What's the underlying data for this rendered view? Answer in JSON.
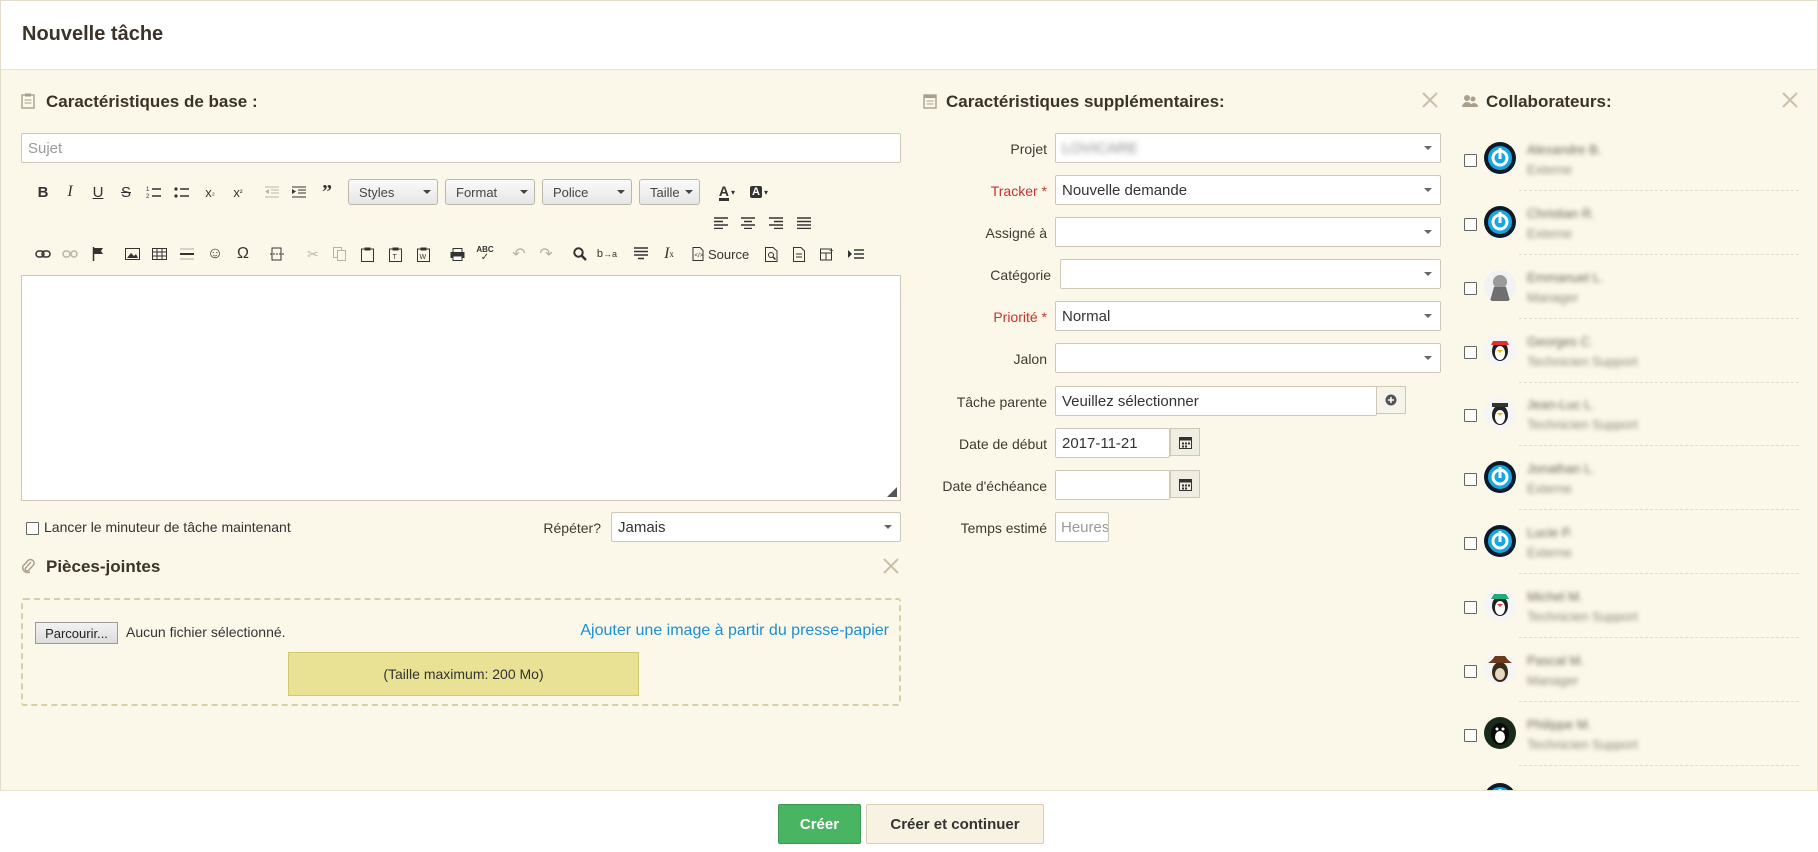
{
  "modal": {
    "title": "Nouvelle tâche"
  },
  "basic": {
    "title": "Caractéristiques de base :",
    "subject_placeholder": "Sujet",
    "toolbar": {
      "styles": "Styles",
      "format": "Format",
      "font": "Police",
      "size": "Taille",
      "source": "Source"
    },
    "timer_label": "Lancer le minuteur de tâche maintenant",
    "repeat_label": "Répéter?",
    "repeat_value": "Jamais"
  },
  "attachments": {
    "title": "Pièces-jointes",
    "browse": "Parcourir...",
    "no_file": "Aucun fichier sélectionné.",
    "paste_link": "Ajouter une image à partir du presse-papier",
    "max_size": "(Taille maximum: 200 Mo)"
  },
  "additional": {
    "title": "Caractéristiques supplémentaires:",
    "fields": {
      "project_label": "Projet",
      "project_value": "LOVICARE",
      "tracker_label": "Tracker *",
      "tracker_value": "Nouvelle demande",
      "assignee_label": "Assigné à",
      "category_label": "Catégorie",
      "priority_label": "Priorité *",
      "priority_value": "Normal",
      "milestone_label": "Jalon",
      "parent_label": "Tâche parente",
      "parent_value": "Veuillez sélectionner",
      "start_label": "Date de début",
      "start_value": "2017-11-21",
      "due_label": "Date d'échéance",
      "estimate_label": "Temps estimé",
      "estimate_placeholder": "Heures"
    }
  },
  "collaborators": {
    "title": "Collaborateurs:",
    "items": [
      {
        "name": "Alexandre B.",
        "role": "Externe",
        "avatar": "power"
      },
      {
        "name": "Christian R.",
        "role": "Externe",
        "avatar": "power"
      },
      {
        "name": "Emmanuel L.",
        "role": "Manager",
        "avatar": "monk"
      },
      {
        "name": "Georges C.",
        "role": "Technicien Support",
        "avatar": "penguin-red"
      },
      {
        "name": "Jean-Luc L.",
        "role": "Technicien Support",
        "avatar": "penguin-hat"
      },
      {
        "name": "Jonathan L.",
        "role": "Externe",
        "avatar": "power"
      },
      {
        "name": "Lucie P.",
        "role": "Externe",
        "avatar": "power"
      },
      {
        "name": "Michel M.",
        "role": "Technicien Support",
        "avatar": "penguin-green"
      },
      {
        "name": "Pascal M.",
        "role": "Manager",
        "avatar": "cowboy"
      },
      {
        "name": "Philippe M.",
        "role": "Technicien Support",
        "avatar": "penguin-dark"
      }
    ]
  },
  "footer": {
    "create": "Créer",
    "create_continue": "Créer et continuer"
  },
  "colors": {
    "body_bg": "#fbf8ea",
    "required": "#c9302c",
    "link": "#1a8fd3",
    "primary": "#49b462"
  }
}
